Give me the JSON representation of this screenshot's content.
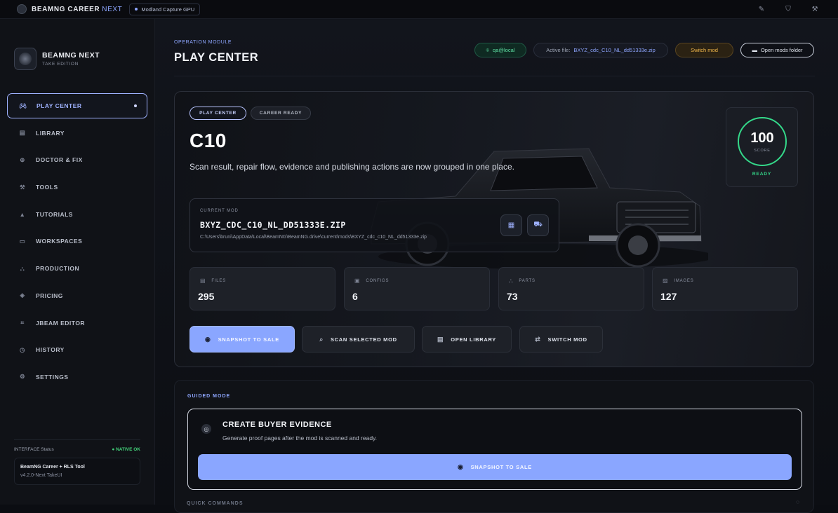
{
  "topbar": {
    "app_name": "BEAMNG CAREER",
    "app_suffix": "NEXT",
    "gpu_label": "Modland Capture GPU",
    "icons": [
      "brush-icon",
      "shield-icon",
      "wrench-icon"
    ]
  },
  "sidebar": {
    "brand_name": "BEAMNG NEXT",
    "brand_sub": "TAKE EDITION",
    "items": [
      {
        "label": "PLAY CENTER",
        "icon": "gamepad-icon",
        "active": true
      },
      {
        "label": "LIBRARY",
        "icon": "library-icon",
        "active": false
      },
      {
        "label": "DOCTOR & FIX",
        "icon": "doctor-icon",
        "active": false
      },
      {
        "label": "TOOLS",
        "icon": "wrench-icon",
        "active": false
      },
      {
        "label": "TUTORIALS",
        "icon": "graduation-icon",
        "active": false
      },
      {
        "label": "WORKSPACES",
        "icon": "workspace-icon",
        "active": false
      },
      {
        "label": "PRODUCTION",
        "icon": "factory-icon",
        "active": false
      },
      {
        "label": "PRICING",
        "icon": "price-tag-icon",
        "active": false
      },
      {
        "label": "JBEAM EDITOR",
        "icon": "editor-icon",
        "active": false
      },
      {
        "label": "HISTORY",
        "icon": "history-icon",
        "active": false
      },
      {
        "label": "SETTINGS",
        "icon": "gear-icon",
        "active": false
      }
    ],
    "status": {
      "label": "INTERFACE Status",
      "state": "● NATIVE OK",
      "tool_name": "BeamNG Career + RLS Tool",
      "version": "v4.2.0-Next TakeUI"
    }
  },
  "header": {
    "breadcrumb": "OPERATION MODULE",
    "title": "PLAY CENTER",
    "user": "qa@local",
    "active_file_label": "Active file:",
    "active_file": "BXYZ_cdc_C10_NL_dd51333e.zip",
    "switch_mod": "Switch mod",
    "open_folder": "Open mods folder"
  },
  "hero": {
    "tag_primary": "PLAY CENTER",
    "tag_secondary": "CAREER READY",
    "title": "C10",
    "description": "Scan result, repair flow, evidence and publishing actions are now grouped in one place.",
    "current_mod_label": "CURRENT MOD",
    "current_mod_name": "BXYZ_CDC_C10_NL_DD51333E.ZIP",
    "current_mod_path": "C:\\Users\\bruni\\AppData\\Local\\BeamNG\\BeamNG.drive\\current\\mods\\BXYZ_cdc_c10_NL_dd51333e.zip",
    "score": "100",
    "score_label": "SCORE",
    "score_status": "READY",
    "stats": [
      {
        "label": "FILES",
        "value": "295"
      },
      {
        "label": "CONFIGS",
        "value": "6"
      },
      {
        "label": "PARTS",
        "value": "73"
      },
      {
        "label": "IMAGES",
        "value": "127"
      }
    ],
    "actions": [
      {
        "label": "SNAPSHOT TO SALE"
      },
      {
        "label": "SCAN SELECTED MOD"
      },
      {
        "label": "OPEN LIBRARY"
      },
      {
        "label": "SWITCH MOD"
      }
    ]
  },
  "guided": {
    "label": "GUIDED MODE",
    "title": "CREATE BUYER EVIDENCE",
    "description": "Generate proof pages after the mod is scanned and ready.",
    "cta": "SNAPSHOT TO SALE",
    "next_section": "QUICK COMMANDS"
  },
  "colors": {
    "accent": "#8aa6ff",
    "success": "#34d98a",
    "warning": "#f2b84b",
    "background": "#0b0d12"
  }
}
